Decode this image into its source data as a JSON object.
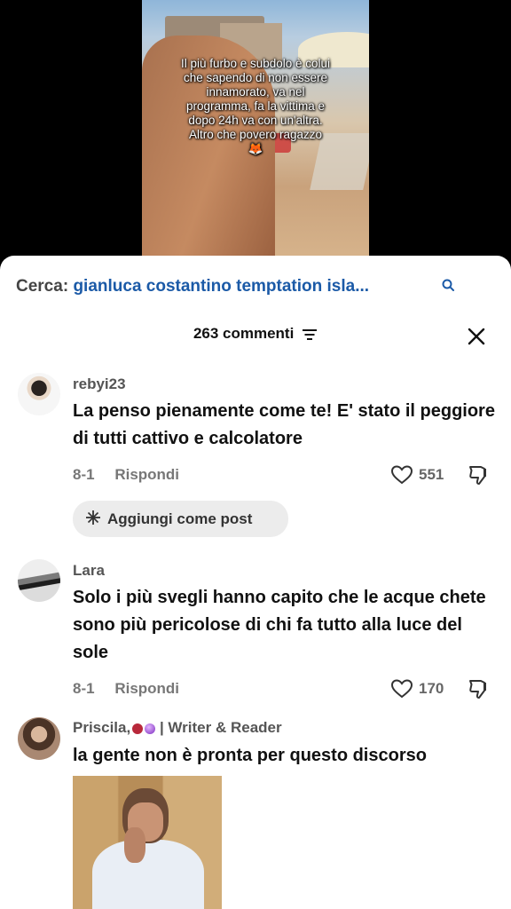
{
  "video": {
    "caption_lines": [
      "Il più furbo e subdolo è colui",
      "che sapendo di non essere",
      "innamorato, va nel",
      "programma, fa la vittima e",
      "dopo 24h va con un'altra.",
      "Altro che povero ragazzo"
    ],
    "caption_emoji": "🦊"
  },
  "search": {
    "label": "Cerca:",
    "query": "gianluca costantino temptation isla...",
    "icon": "search-icon"
  },
  "header": {
    "comment_count": "263 commenti",
    "icons": [
      "filter-icon",
      "close-icon"
    ]
  },
  "comments": [
    {
      "username": "rebyi23",
      "text": "La penso pienamente come te! E' stato il peggiore di tutti cattivo e calcolatore",
      "date": "8-1",
      "reply_label": "Rispondi",
      "likes": "551"
    },
    {
      "username": "Lara",
      "text": "Solo i più svegli hanno capito che le acque chete sono più pericolose di chi fa tutto alla luce del sole",
      "date": "8-1",
      "reply_label": "Rispondi",
      "likes": "170"
    },
    {
      "username": "Priscila,",
      "username_suffix": "| Writer & Reader",
      "text": "la gente non è pronta per questo discorso"
    }
  ],
  "post_chip": {
    "label": "Aggiungi come post"
  },
  "colors": {
    "accent": "#1b5aa7",
    "chip_bg": "#ececec"
  }
}
